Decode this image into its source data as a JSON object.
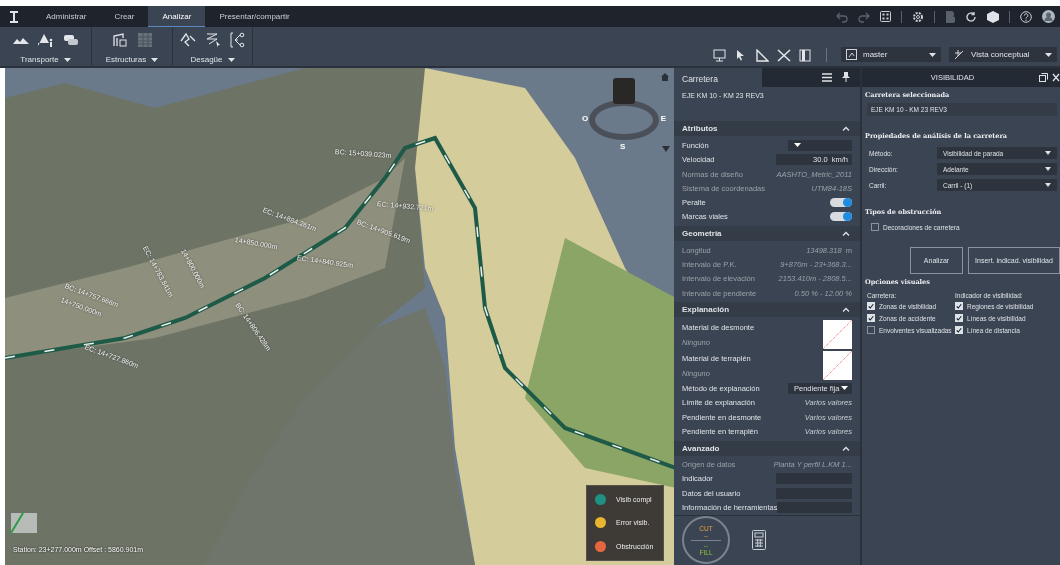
{
  "app_tabs": [
    {
      "label": "Administrar",
      "selected": false
    },
    {
      "label": "Crear",
      "selected": false
    },
    {
      "label": "Analizar",
      "selected": true
    },
    {
      "label": "Presentar/compartir",
      "selected": false
    }
  ],
  "ribbon_groups": [
    {
      "label": "Transporte"
    },
    {
      "label": "Estructuras"
    },
    {
      "label": "Desagüe"
    }
  ],
  "view_toolbar": {
    "branch": "master",
    "view_style": "Vista conceptual"
  },
  "viewport": {
    "station_labels": [
      "BC: 15+039.023m",
      "EC: 14+884.261m",
      "EC: 14+932.721m",
      "BC: 14+905.619m",
      "14+850.000m",
      "EC: 14+840.925m",
      "EC: 14+783.841m",
      "14+800.000m",
      "BC: 14+757.666m",
      "14+750.000m",
      "BC: 14+806.428m",
      "EC: 14+727.860m"
    ],
    "compass": [
      "O",
      "E",
      "S"
    ],
    "legend": [
      {
        "label": "Visib compl",
        "color": "#1f9185"
      },
      {
        "label": "Error visib.",
        "color": "#e8b52e"
      },
      {
        "label": "Obstrucción",
        "color": "#e5673f"
      }
    ],
    "status": "Station: 23+277.000m Offset : 5860.901m"
  },
  "properties_panel": {
    "title": "Carretera",
    "subtitle": "EJE KM 10 - KM 23 REV3",
    "sections": [
      {
        "title": "Atributos",
        "expanded": true,
        "rows": [
          {
            "kind": "dropdown",
            "label": "Función"
          },
          {
            "kind": "input",
            "label": "Velocidad",
            "value": "30.0",
            "unit": "km/h"
          },
          {
            "kind": "readonly",
            "label": "Normas de diseño",
            "value": "AASHTO_Metric_2011"
          },
          {
            "kind": "readonly",
            "label": "Sistema de coordenadas",
            "value": "UTM84-18S"
          },
          {
            "kind": "toggle",
            "label": "Peralte",
            "on": true
          },
          {
            "kind": "toggle",
            "label": "Marcas viales",
            "on": true
          }
        ]
      },
      {
        "title": "Geometría",
        "expanded": true,
        "rows": [
          {
            "kind": "readonly",
            "label": "Longitud",
            "value": "13498.318",
            "unit": "m"
          },
          {
            "kind": "readonly",
            "label": "Intervalo de P.K.",
            "value": "9+870m - 23+368.3..."
          },
          {
            "kind": "readonly",
            "label": "Intervalo de elevación",
            "value": "2153.410m - 2808.5..."
          },
          {
            "kind": "readonly",
            "label": "Intervalo de pendiente",
            "value": "0.50 % - 12.00 %"
          }
        ]
      },
      {
        "title": "Explanación",
        "expanded": true,
        "rows": [
          {
            "kind": "material",
            "label": "Material de desmonte",
            "value": "Ninguno"
          },
          {
            "kind": "material",
            "label": "Material de terraplén",
            "value": "Ninguno"
          },
          {
            "kind": "dropdown",
            "label": "Método de explanación",
            "value": "Pendiente fija"
          },
          {
            "kind": "multi",
            "label": "Límite de explanación",
            "value": "Varios valores"
          },
          {
            "kind": "multi",
            "label": "Pendiente en desmonte",
            "value": "Varios valores"
          },
          {
            "kind": "multi",
            "label": "Pendiente en terraplén",
            "value": "Varios valores"
          }
        ]
      },
      {
        "title": "Avanzado",
        "expanded": true,
        "rows": [
          {
            "kind": "readonly",
            "label": "Origen de datos",
            "value": "Planta Y perfil L.KM 1..."
          },
          {
            "kind": "input",
            "label": "Indicador"
          },
          {
            "kind": "input",
            "label": "Datos del usuario"
          },
          {
            "kind": "input",
            "label": "Información de herramientas"
          }
        ]
      }
    ],
    "gauge": {
      "cut_label": "CUT",
      "cut_value": "--",
      "fill_value": "--",
      "fill_label": "FILL"
    }
  },
  "visibility": {
    "title": "VISIBILIDAD",
    "selected_heading": "Carretera seleccionada",
    "selected_road": "EJE KM 10 - KM 23 REV3",
    "props_heading": "Propiedades de análisis de la carretera",
    "fields": [
      {
        "label": "Método:",
        "value": "Visibilidad de parada"
      },
      {
        "label": "Dirección:",
        "value": "Adelante"
      },
      {
        "label": "Carril:",
        "value": "Carril - (1)"
      }
    ],
    "obstruction_heading": "Tipos de obstrucción",
    "obstructions": [
      {
        "label": "Decoraciones de carretera",
        "checked": false
      }
    ],
    "buttons": [
      "Analizar",
      "Insert. indicad. visibilidad"
    ],
    "visual_heading": "Opciones visuales",
    "visual_options": [
      {
        "title": "Carretera:",
        "options": [
          {
            "label": "Zonas de visibilidad",
            "checked": true
          },
          {
            "label": "Zonas de accidente",
            "checked": true
          },
          {
            "label": "Envolventes visualizadas",
            "checked": false
          }
        ]
      },
      {
        "title": "Indicador de visibilidad:",
        "options": [
          {
            "label": "Regiones de visibilidad",
            "checked": true
          },
          {
            "label": "Líneas de visibilidad",
            "checked": true
          },
          {
            "label": "Línea de distancia",
            "checked": true
          }
        ]
      }
    ]
  }
}
